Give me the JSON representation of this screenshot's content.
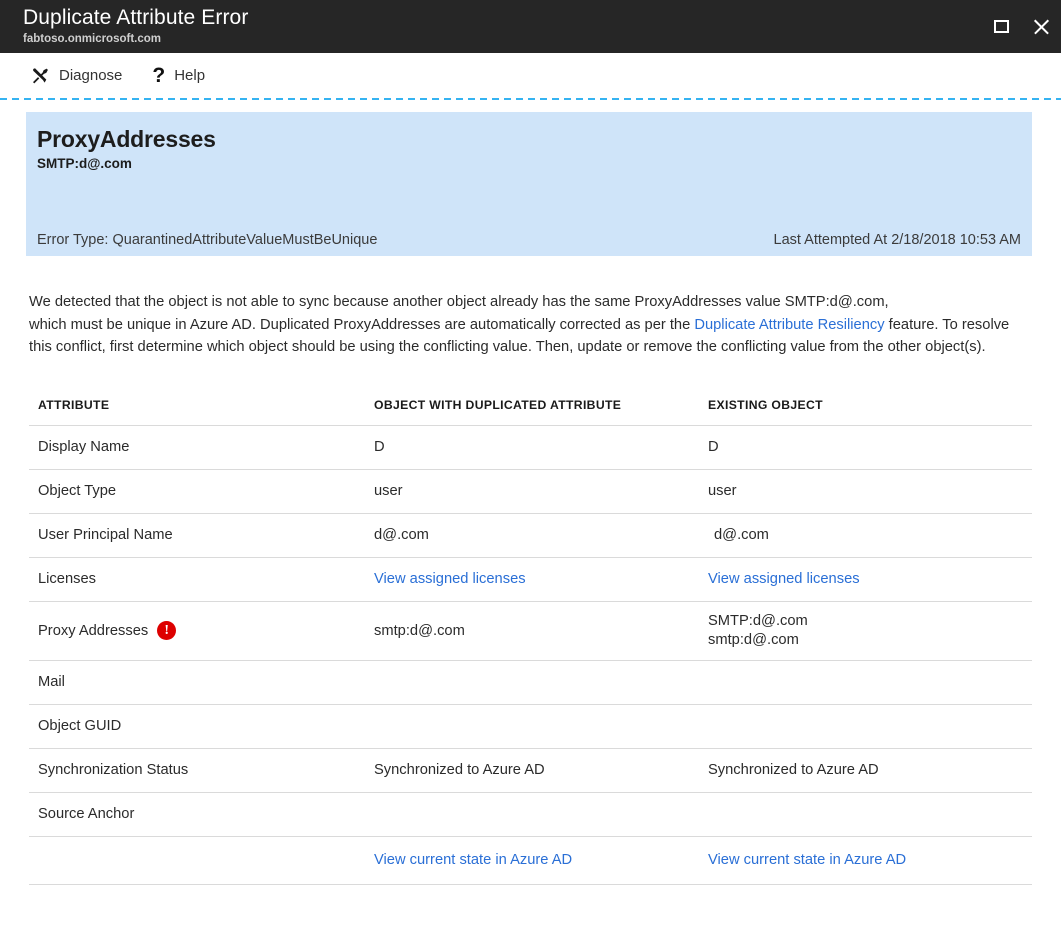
{
  "window": {
    "title": "Duplicate Attribute Error",
    "subtitle": "fabtoso.onmicrosoft.com",
    "maximize_label": "Maximize",
    "close_label": "Close"
  },
  "toolbar": {
    "diagnose_label": "Diagnose",
    "help_label": "Help",
    "help_glyph": "?"
  },
  "banner": {
    "attribute_name": "ProxyAddresses",
    "attribute_value": "SMTP:d@.com",
    "error_type": "Error Type: QuarantinedAttributeValueMustBeUnique",
    "last_attempted": "Last Attempted At 2/18/2018 10:53 AM",
    "background_color": "#cfe4f9"
  },
  "description": {
    "part1": "We detected that the object is not able to sync because another object already has the same ProxyAddresses value SMTP:d@.com,",
    "part2": "which must be unique in Azure AD. Duplicated ProxyAddresses are automatically corrected as per the ",
    "link_text": "Duplicate Attribute Resiliency",
    "part3": " feature. To resolve this conflict, first determine which object should be using the conflicting value. Then, update or remove the conflicting value from the other object(s)."
  },
  "table": {
    "headers": [
      "ATTRIBUTE",
      "OBJECT WITH DUPLICATED ATTRIBUTE",
      "EXISTING OBJECT"
    ],
    "rows": [
      {
        "attribute": "Display Name",
        "duplicated": "D",
        "existing": "D"
      },
      {
        "attribute": "Object Type",
        "duplicated": "user",
        "existing": "user"
      },
      {
        "attribute": "User Principal Name",
        "duplicated": "d@.com",
        "existing": "d@.com"
      },
      {
        "attribute": "Licenses",
        "duplicated": "View assigned licenses",
        "existing": "View assigned licenses"
      },
      {
        "attribute": "Proxy Addresses",
        "duplicated": "smtp:d@.com",
        "existing_line1": "SMTP:d@.com",
        "existing_line2": "smtp:d@.com"
      },
      {
        "attribute": "Mail",
        "duplicated": "",
        "existing": ""
      },
      {
        "attribute": "Object GUID",
        "duplicated": "",
        "existing": ""
      },
      {
        "attribute": "Synchronization Status",
        "duplicated": "Synchronized to Azure AD",
        "existing": "Synchronized to Azure AD"
      },
      {
        "attribute": "Source Anchor",
        "duplicated": "",
        "existing": ""
      }
    ],
    "footer_link_duplicated": "View current state in Azure AD",
    "footer_link_existing": "View current state in Azure AD"
  },
  "colors": {
    "link": "#2a6fd6",
    "error": "#dd0000",
    "titlebar": "#262626",
    "divider": "#35b3f1"
  }
}
